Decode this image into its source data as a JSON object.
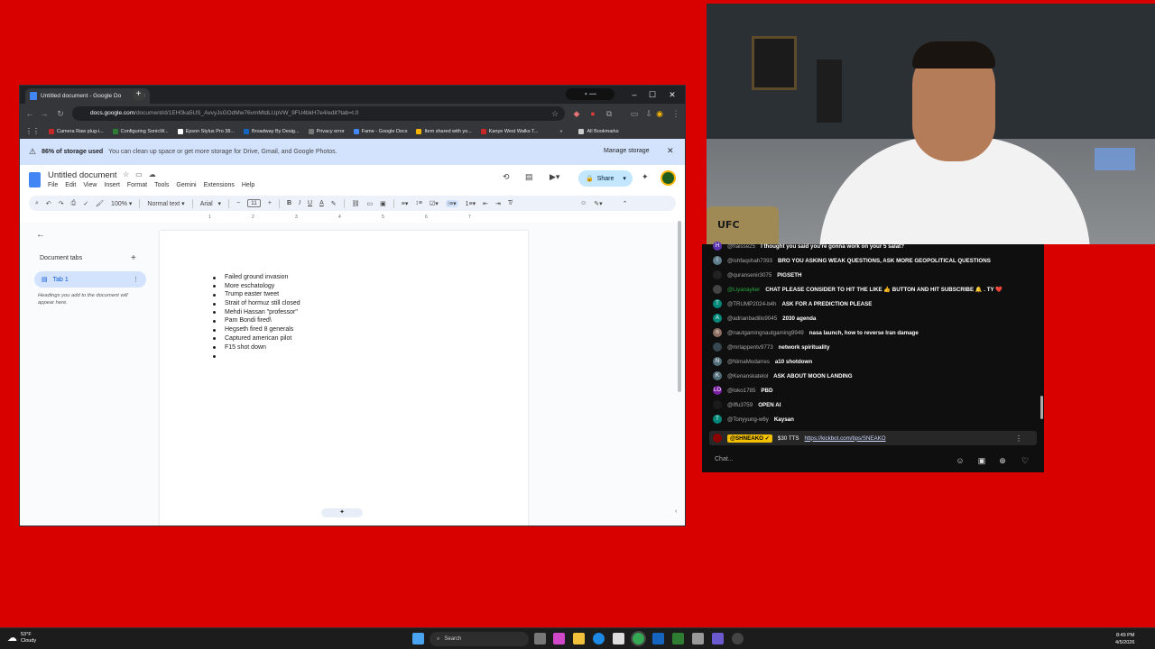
{
  "browser": {
    "tab_title": "Untitled document - Google Do",
    "url_host": "docs.google.com",
    "url_path": "/document/d/1EH0ka5US_AvvyJsGOdMw76vmMtdLUpVW_9FU4bkH7e4/edit?tab=t.0",
    "bookmarks": [
      {
        "label": "Camera Raw plug-i...",
        "color": "#c62828"
      },
      {
        "label": "Configuring SonicW...",
        "color": "#2e7d32"
      },
      {
        "label": "Epson Stylus Pro 38...",
        "color": "#ffffff"
      },
      {
        "label": "Broadway By Desig...",
        "color": "#1565c0"
      },
      {
        "label": "Privacy error",
        "color": "#777777"
      },
      {
        "label": "Fame - Google Docs",
        "color": "#4285f4"
      },
      {
        "label": "Item shared with yo...",
        "color": "#f4b400"
      },
      {
        "label": "Kanye West Walks T...",
        "color": "#c62828"
      }
    ],
    "all_bookmarks": "All Bookmarks"
  },
  "banner": {
    "bold": "86% of storage used",
    "message": "You can clean up space or get more storage for Drive, Gmail, and Google Photos.",
    "action": "Manage storage"
  },
  "docs": {
    "title": "Untitled document",
    "menu": [
      "File",
      "Edit",
      "View",
      "Insert",
      "Format",
      "Tools",
      "Gemini",
      "Extensions",
      "Help"
    ],
    "share_label": "Share",
    "zoom": "100%",
    "style": "Normal text",
    "font": "Arial",
    "font_size": "11",
    "sidebar": {
      "heading": "Document tabs",
      "tab_label": "Tab 1",
      "hint": "Headings you add to the document will appear here."
    },
    "ruler_ticks": [
      "1",
      "2",
      "3",
      "4",
      "5",
      "6",
      "7"
    ],
    "bullets": [
      "Failed ground invasion",
      "More eschatology",
      "Trump easter tweet",
      "Strait of hormuz still closed",
      "Mehdi Hassan \"professor\"",
      "Pam Bondi fired\\",
      "Hegseth fired 8 generals",
      "Captured american pilot",
      "F15 shot down",
      ""
    ]
  },
  "chat": {
    "messages": [
      {
        "user": "@haisse25",
        "text": "I thought you said you're gonna work on your 5 salat?",
        "avatar": "H",
        "color": "#5e35b1"
      },
      {
        "user": "@ishfaqshah7393",
        "text": "BRO YOU ASKING WEAK QUESTIONS, ASK MORE GEOPOLITICAL QUESTIONS",
        "avatar": "I",
        "color": "#607d8b"
      },
      {
        "user": "@quransenir3075",
        "text": "PIGSETH",
        "avatar": "",
        "color": "#222222"
      },
      {
        "user": "@Liyanayker",
        "text": "CHAT PLEASE CONSIDER TO HIT THE LIKE 👍 BUTTON AND HIT SUBSCRIBE 🔔 . TY ❤️",
        "avatar": "",
        "color": "#444444",
        "usercolor": "#2ba640"
      },
      {
        "user": "@TRUMP2024-b4h",
        "text": "ASK FOR A PREDICTION PLEASE",
        "avatar": "T",
        "color": "#00897b"
      },
      {
        "user": "@adrianbadillo9045",
        "text": "2030 agenda",
        "avatar": "A",
        "color": "#00897b"
      },
      {
        "user": "@nautgamingnautgaming9949",
        "text": "nasa launch, how to reverse Iran damage",
        "avatar": "n",
        "color": "#8d6e63"
      },
      {
        "user": "@mrlappentv9773",
        "text": "network spirituality",
        "avatar": "",
        "color": "#37474f"
      },
      {
        "user": "@NimaModarres",
        "text": "a10 shotdown",
        "avatar": "N",
        "color": "#546e7a"
      },
      {
        "user": "@Kenanskatelol",
        "text": "ASK ABOUT MOON LANDING",
        "avatar": "K",
        "color": "#546e7a"
      },
      {
        "user": "@loko1785",
        "text": "PBD",
        "avatar": "LO",
        "color": "#7b1fa2"
      },
      {
        "user": "@iffu3759",
        "text": "OPEN AI",
        "avatar": "",
        "color": "#1b1b1b"
      },
      {
        "user": "@Tonyyung-w6y",
        "text": "Kaysan",
        "avatar": "T",
        "color": "#00897b"
      }
    ],
    "pinned": {
      "user": "@SHNEAKO ✓",
      "text": "$30 TTS",
      "link": "https://kickbot.com/tips/SNEAKO"
    },
    "input_placeholder": "Chat..."
  },
  "webcam": {
    "belt_text": "UFC"
  },
  "taskbar": {
    "temp": "53°F",
    "condition": "Cloudy",
    "search_placeholder": "Search",
    "time": "8:49 PM",
    "date": "4/5/2026"
  }
}
